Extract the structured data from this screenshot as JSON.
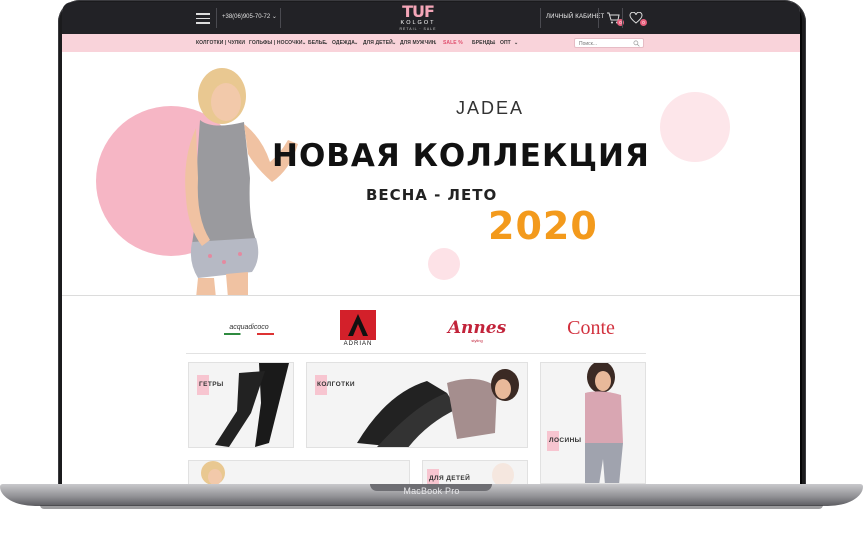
{
  "device": {
    "model_label": "MacBook Pro"
  },
  "header": {
    "phone": "+38(06)905-70-72",
    "logo": {
      "main": "TUF",
      "sub": "KOLGOT",
      "tagline": "RETAIL · SALE"
    },
    "account_label": "ЛИЧНЫЙ КАБИНЕТ",
    "cart_count": "0",
    "fav_count": "0"
  },
  "nav": {
    "items": [
      {
        "label": "КОЛГОТКИ | ЧУЛКИ"
      },
      {
        "label": "ГОЛЬФЫ | НОСОЧКИ"
      },
      {
        "label": "БЕЛЬЕ"
      },
      {
        "label": "ОДЕЖДА"
      },
      {
        "label": "ДЛЯ ДЕТЕЙ"
      },
      {
        "label": "ДЛЯ МУЖЧИН"
      },
      {
        "label": "SALE %"
      },
      {
        "label": "БРЕНДЫ"
      },
      {
        "label": "ОПТ"
      }
    ],
    "search_placeholder": "Поиск..."
  },
  "hero": {
    "brand": "JADEA",
    "headline": "НОВАЯ КОЛЛЕКЦИЯ",
    "season": "ВЕСНА - ЛЕТО",
    "year": "2020"
  },
  "brands": [
    {
      "name": "acquadicoco"
    },
    {
      "name": "ADRIAN"
    },
    {
      "name": "Annes",
      "sub": "styling"
    },
    {
      "name": "Conte"
    }
  ],
  "categories": [
    {
      "label": "ГЕТРЫ"
    },
    {
      "label": "КОЛГОТКИ"
    },
    {
      "label": "ЛОСИНЫ"
    },
    {
      "label": ""
    },
    {
      "label": "ДЛЯ ДЕТЕЙ"
    }
  ],
  "colors": {
    "accent_pink": "#f9d3da",
    "sale": "#e0506e",
    "year": "#f39a1c",
    "topbar": "#222226"
  }
}
